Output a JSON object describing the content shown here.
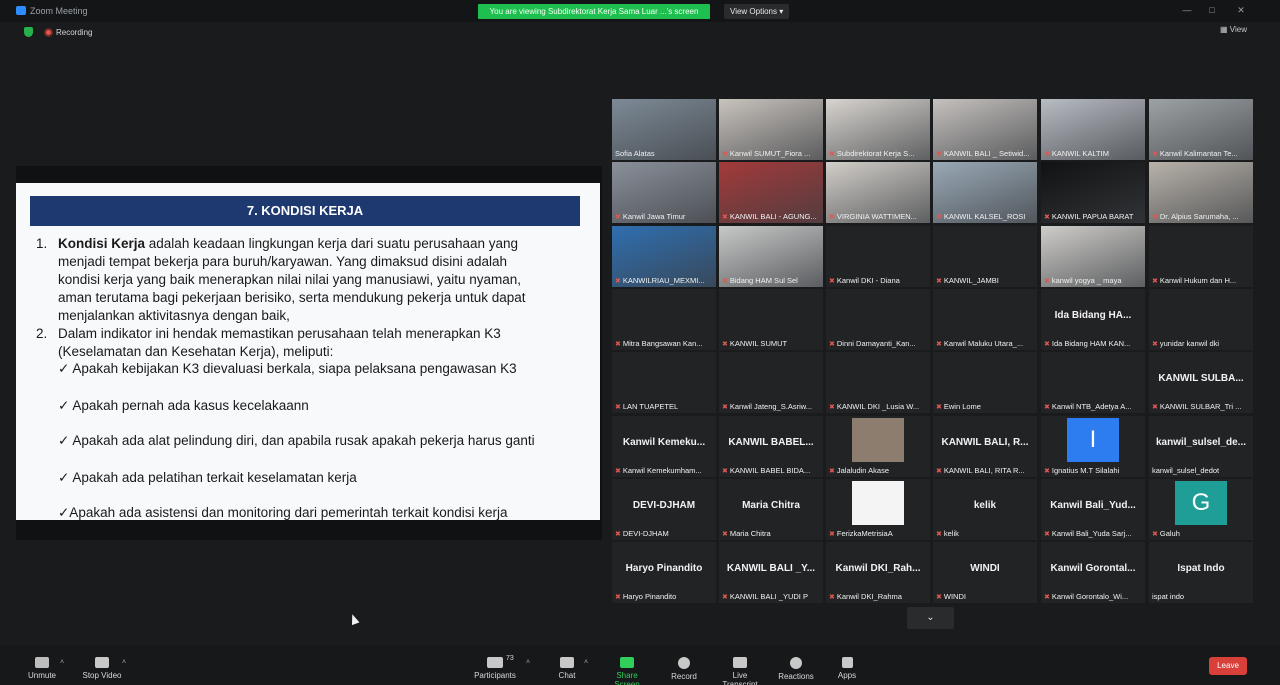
{
  "window": {
    "title": "Zoom Meeting",
    "viewing_banner": "You are viewing Subdirektorat Kerja Sama Luar ...'s screen",
    "view_options": "View Options ▾",
    "recording": "Recording",
    "view_label": "View"
  },
  "slide": {
    "heading": "7. KONDISI KERJA",
    "item1_num": "1.",
    "item1_bold": "Kondisi Kerja",
    "item1_line1_rest": " adalah keadaan lingkungan kerja dari suatu perusahaan yang",
    "item1_line2": "menjadi tempat bekerja  para buruh/karyawan. Yang dimaksud disini adalah",
    "item1_line3": "kondisi kerja yang baik menerapkan nilai nilai yang manusiawi, yaitu nyaman,",
    "item1_line4": "aman terutama bagi pekerjaan berisiko, serta mendukung pekerja untuk dapat",
    "item1_line5": "menjalankan aktivitasnya dengan baik,",
    "item2_num": "2.",
    "item2_line1": "Dalam indikator ini hendak memastikan perusahaan telah menerapkan K3",
    "item2_line2": "(Keselamatan dan Kesehatan Kerja), meliputi:",
    "check1": "✓ Apakah kebijakan K3 dievaluasi berkala, siapa pelaksana pengawasan K3",
    "check2": "✓ Apakah pernah ada kasus kecelakaann",
    "check3": "✓ Apakah ada alat pelindung diri, dan apabila rusak apakah pekerja harus ganti",
    "check4": "✓ Apakah ada pelatihan terkait keselamatan kerja",
    "check5": "✓Apakah ada asistensi dan monitoring dari pemerintah terkait kondisi kerja"
  },
  "participants_grid": [
    {
      "name": "Sofia Alatas",
      "display": "",
      "video": true,
      "muted": false,
      "active": true,
      "color": "#7d8a96"
    },
    {
      "name": "Kanwil SUMUT_Fiora ...",
      "display": "",
      "video": true,
      "muted": true,
      "color": "#c9c3bd"
    },
    {
      "name": "Subdirektorat Kerja S...",
      "display": "",
      "video": true,
      "muted": true,
      "color": "#d8d4cf"
    },
    {
      "name": "KANWIL BALI _ Setiwid...",
      "display": "",
      "video": true,
      "muted": true,
      "color": "#c5c1be"
    },
    {
      "name": "KANWIL KALTIM",
      "display": "",
      "video": true,
      "muted": true,
      "color": "#b8bcc3"
    },
    {
      "name": "Kanwil Kalimantan Te...",
      "display": "",
      "video": true,
      "muted": true,
      "color": "#9da2a5"
    },
    {
      "name": "Kanwil Jawa Timur",
      "display": "",
      "video": true,
      "muted": true,
      "color": "#8a909a"
    },
    {
      "name": "KANWIL BALI - AGUNG...",
      "display": "",
      "video": true,
      "muted": true,
      "color": "#a33a3a"
    },
    {
      "name": "VIRGINIA WATTIMEN...",
      "display": "",
      "video": true,
      "muted": true,
      "color": "#d2cec9"
    },
    {
      "name": "KANWIL KALSEL_ROSI",
      "display": "",
      "video": true,
      "muted": true,
      "color": "#9aa9b6"
    },
    {
      "name": "KANWIL PAPUA BARAT",
      "display": "",
      "video": true,
      "muted": true,
      "color": "#111213"
    },
    {
      "name": "Dr. Alpius Sarumaha, ...",
      "display": "",
      "video": true,
      "muted": true,
      "color": "#b8b2aa"
    },
    {
      "name": "KANWILRIAU_MEXMI...",
      "display": "",
      "video": true,
      "muted": true,
      "color": "#2f6fb0"
    },
    {
      "name": "Bidang HAM Sul Sel",
      "display": "",
      "video": true,
      "muted": true,
      "color": "#c7c9c8"
    },
    {
      "name": "Kanwil DKI - Diana",
      "display": "",
      "video": false,
      "muted": true
    },
    {
      "name": "KANWIL_JAMBI",
      "display": "",
      "video": false,
      "muted": true
    },
    {
      "name": "kanwil yogya _ maya",
      "display": "",
      "video": true,
      "muted": true,
      "color": "#cfcdca"
    },
    {
      "name": "Kanwil Hukum dan H...",
      "display": "",
      "video": false,
      "muted": true
    },
    {
      "name": "Mitra Bangsawan Kan...",
      "display": "",
      "video": false,
      "muted": true
    },
    {
      "name": "KANWIL SUMUT",
      "display": "",
      "video": false,
      "muted": true
    },
    {
      "name": "Dinni Damayanti_Kan...",
      "display": "",
      "video": false,
      "muted": true
    },
    {
      "name": "Kanwil Maluku Utara_...",
      "display": "",
      "video": false,
      "muted": true
    },
    {
      "name": "Ida Bidang HAM KAN...",
      "display": "Ida Bidang HA...",
      "video": false,
      "muted": true
    },
    {
      "name": "yunidar kanwil dki",
      "display": "",
      "video": false,
      "muted": true
    },
    {
      "name": "LAN TUAPETEL",
      "display": "",
      "video": false,
      "muted": true
    },
    {
      "name": "Kanwil Jateng_S.Asriw...",
      "display": "",
      "video": false,
      "muted": true
    },
    {
      "name": "KANWIL DKI _Lusia W...",
      "display": "",
      "video": false,
      "muted": true
    },
    {
      "name": "Ewin Lome",
      "display": "",
      "video": false,
      "muted": true
    },
    {
      "name": "Kanwil NTB_Adetya A...",
      "display": "",
      "video": false,
      "muted": true
    },
    {
      "name": "KANWIL SULBAR_Tri ...",
      "display": "KANWIL SULBA...",
      "video": false,
      "muted": true
    },
    {
      "name": "Kanwil Kemekumham...",
      "display": "Kanwil Kemeku...",
      "video": false,
      "muted": true
    },
    {
      "name": "KANWIL BABEL BIDA...",
      "display": "KANWIL BABEL...",
      "video": false,
      "muted": true
    },
    {
      "name": "Jalaludin Akase",
      "display": "",
      "video": false,
      "muted": true,
      "photo": "#8c7d6e"
    },
    {
      "name": "KANWIL BALI, RITA R...",
      "display": "KANWIL BALI, R...",
      "video": false,
      "muted": true
    },
    {
      "name": "Ignatius M.T Silalahi",
      "display": "",
      "video": false,
      "muted": true,
      "letter": "I",
      "letter_color": "#2d7cf0"
    },
    {
      "name": "kanwil_sulsel_dedot",
      "display": "kanwil_sulsel_de...",
      "video": false,
      "muted": false
    },
    {
      "name": "DEVI-DJHAM",
      "display": "DEVI-DJHAM",
      "video": false,
      "muted": true
    },
    {
      "name": "Maria Chitra",
      "display": "Maria Chitra",
      "video": false,
      "muted": true
    },
    {
      "name": "FerizkaMetrisiaA",
      "display": "",
      "video": false,
      "muted": true,
      "photo": "#f4f4f4"
    },
    {
      "name": "kelik",
      "display": "kelik",
      "video": false,
      "muted": true
    },
    {
      "name": "Kanwil Bali_Yuda Sarj...",
      "display": "Kanwil  Bali_Yud...",
      "video": false,
      "muted": true
    },
    {
      "name": "Galuh",
      "display": "",
      "video": false,
      "muted": true,
      "letter": "G",
      "letter_color": "#1f9e97"
    },
    {
      "name": "Haryo Pinandito",
      "display": "Haryo Pinandito",
      "video": false,
      "muted": true
    },
    {
      "name": "KANWIL BALI _YUDI P",
      "display": "KANWIL BALI _Y...",
      "video": false,
      "muted": true
    },
    {
      "name": "Kanwil DKI_Rahma",
      "display": "Kanwil  DKI_Rah...",
      "video": false,
      "muted": true
    },
    {
      "name": "WINDI",
      "display": "WINDI",
      "video": false,
      "muted": true
    },
    {
      "name": "Kanwil Gorontalo_Wi...",
      "display": "Kanwil  Gorontal...",
      "video": false,
      "muted": true
    },
    {
      "name": "ispat indo",
      "display": "Ispat Indo",
      "video": false,
      "muted": false
    }
  ],
  "toolbar": {
    "unmute": "Unmute",
    "stop_video": "Stop Video",
    "participants": "Participants",
    "participants_count": "73",
    "chat": "Chat",
    "share_screen": "Share Screen",
    "record": "Record",
    "live_transcript": "Live Transcript",
    "reactions": "Reactions",
    "apps": "Apps",
    "leave": "Leave"
  },
  "colors": {
    "banner": "#1fbf4f",
    "slide_header": "#1e3870",
    "leave": "#d9403a",
    "active_speaker": "#7cd43e"
  }
}
